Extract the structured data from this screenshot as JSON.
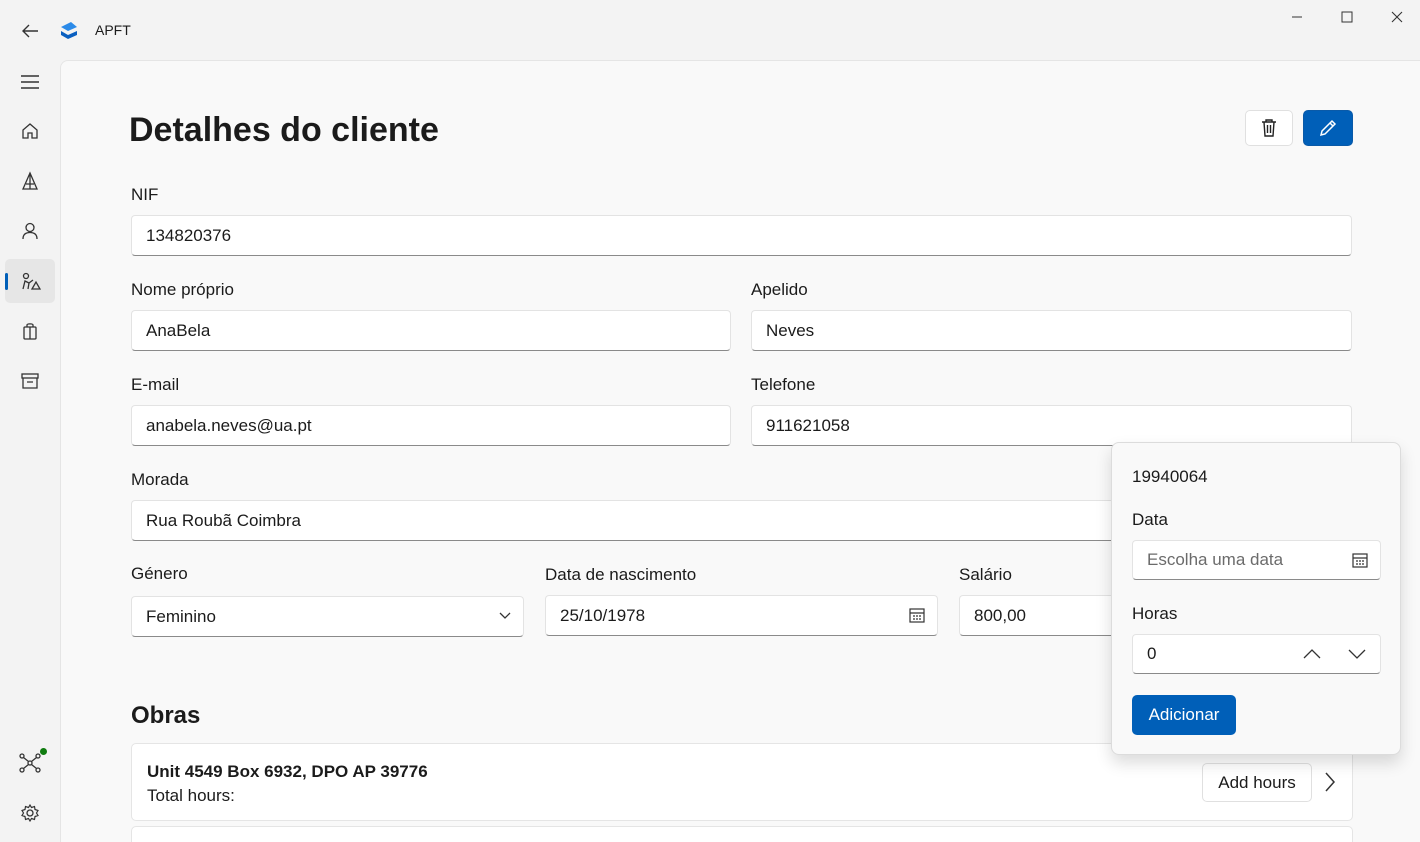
{
  "window": {
    "title": "APFT",
    "accent": "#005fb8"
  },
  "nav": {
    "items": [
      "menu-icon",
      "home-icon",
      "pyramid-icon",
      "person-icon",
      "workers-icon",
      "shopping-bag-icon",
      "archive-icon"
    ],
    "selected": "workers-icon",
    "bottom": [
      "network-icon",
      "gear-icon"
    ],
    "status_color": "#0f7b0f"
  },
  "page": {
    "title": "Detalhes do cliente",
    "fields": {
      "nif": {
        "label": "NIF",
        "value": "134820376"
      },
      "nome": {
        "label": "Nome próprio",
        "value": "AnaBela"
      },
      "apelido": {
        "label": "Apelido",
        "value": "Neves"
      },
      "email": {
        "label": "E-mail",
        "value": "anabela.neves@ua.pt"
      },
      "telefone": {
        "label": "Telefone",
        "value": "911621058"
      },
      "morada": {
        "label": "Morada",
        "value": "Rua Roubã Coimbra"
      },
      "genero": {
        "label": "Género",
        "value": "Feminino"
      },
      "nascimento": {
        "label": "Data de nascimento",
        "value": "25/10/1978"
      },
      "salario": {
        "label": "Salário",
        "value": "800,00"
      }
    },
    "obras": {
      "title": "Obras",
      "items": [
        {
          "address": "Unit 4549 Box 6932, DPO AP 39776",
          "hours_label": "Total hours:",
          "button": "Add hours"
        }
      ]
    }
  },
  "flyout": {
    "id": "19940064",
    "date_label": "Data",
    "date_placeholder": "Escolha uma data",
    "hours_label": "Horas",
    "hours_value": "0",
    "submit": "Adicionar"
  }
}
